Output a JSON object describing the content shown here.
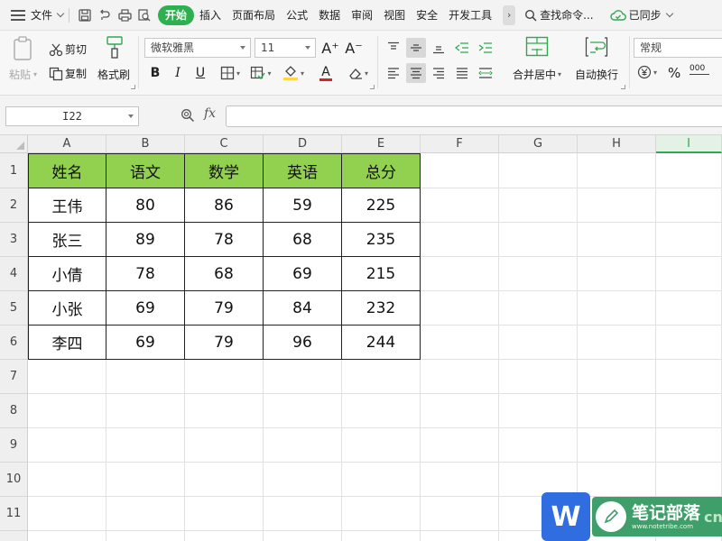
{
  "menubar": {
    "file_label": "文件",
    "tabs": [
      "开始",
      "插入",
      "页面布局",
      "公式",
      "数据",
      "审阅",
      "视图",
      "安全",
      "开发工具"
    ],
    "active_tab": "开始",
    "more_label": "›",
    "search_label": "查找命令...",
    "sync_label": "已同步"
  },
  "ribbon": {
    "paste_label": "粘贴",
    "cut_label": "剪切",
    "copy_label": "复制",
    "format_painter_label": "格式刷",
    "font_name": "微软雅黑",
    "font_size": "11",
    "grow_font": "A⁺",
    "shrink_font": "A⁻",
    "bold": "B",
    "italic": "I",
    "underline": "U",
    "font_color_letter": "A",
    "merge_label": "合并居中",
    "wrap_label": "自动换行",
    "number_format": "常规",
    "percent": "%",
    "thousands": "000",
    "colors": {
      "fill": "#ffd54a",
      "font": "#e02020"
    }
  },
  "formula_bar": {
    "name_box": "I22",
    "fx_label": "fx",
    "formula": ""
  },
  "sheet": {
    "columns": [
      "A",
      "B",
      "C",
      "D",
      "E",
      "F",
      "G",
      "H",
      "I"
    ],
    "selected_column": "I",
    "rows": [
      "1",
      "2",
      "3",
      "4",
      "5",
      "6",
      "7",
      "8",
      "9",
      "10",
      "11"
    ],
    "header_fill": "#92d050",
    "table_header": [
      "姓名",
      "语文",
      "数学",
      "英语",
      "总分"
    ],
    "table_rows": [
      [
        "王伟",
        "80",
        "86",
        "59",
        "225"
      ],
      [
        "张三",
        "89",
        "78",
        "68",
        "235"
      ],
      [
        "小倩",
        "78",
        "68",
        "69",
        "215"
      ],
      [
        "小张",
        "69",
        "79",
        "84",
        "232"
      ],
      [
        "李四",
        "69",
        "79",
        "96",
        "244"
      ]
    ]
  },
  "watermark": {
    "logo_letter": "W",
    "title": "笔记部落",
    "url": "www.notetribe.com",
    "cn": "cn"
  }
}
